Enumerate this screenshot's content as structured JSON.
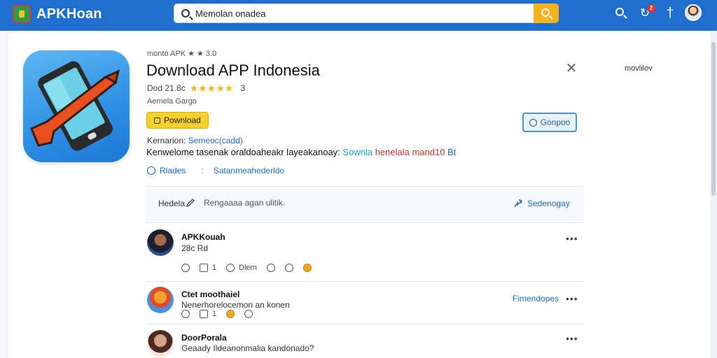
{
  "header": {
    "logo_text": "APKHoan",
    "search": {
      "value": "Memolan onadea"
    },
    "notification_count": "2"
  },
  "side": {
    "right_label": "movlilov"
  },
  "app": {
    "breadcrumb": "monto APK ★ ★ 3.0",
    "title": "Download APP Indonesia",
    "rating_prefix": "Dod 21.8c",
    "stars": "★★★★★",
    "rating_count": "3",
    "meta_sub": "Aemela Gargo",
    "download_label": "Pownload",
    "connect_label": "Gonpoo",
    "version_label": "Kernarion:",
    "version_value": "Semeoc(cadd)",
    "description_main": "Kenwelome tasenak oraldoaheakr layeakanoay:",
    "description_link": "Sownla",
    "description_hl": "henelala mand10",
    "description_hl2": "Bt",
    "action_like": "Rlades",
    "action_sep": ":",
    "action_other": "Satanmeahederldo"
  },
  "composer": {
    "label": "Hedela",
    "placeholder": "Rengaaaa agan ulitik.",
    "share_label": "Sedenogay"
  },
  "comments": [
    {
      "name": "APKKouah",
      "text": "28c Rd",
      "actions": {
        "reply_count": "1",
        "share_label": "Dlem"
      }
    },
    {
      "name": "Ctet moothaiel",
      "text": "Nenerhorelocemon an konen",
      "actions": {
        "reply_count": "1",
        "share_label": ""
      },
      "translate_label": "Fimendopes"
    },
    {
      "name": "DoorPorala",
      "text": "Geaady Ildeanonmalia kandonado?"
    }
  ]
}
